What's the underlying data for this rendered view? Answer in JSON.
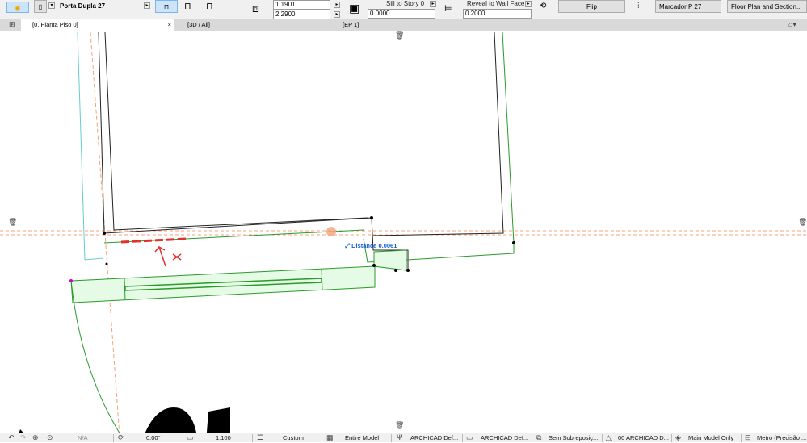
{
  "toolbar": {
    "door_name": "Porta Dupla 27",
    "width_value": "1.1901",
    "height_value": "2.2900",
    "sill_label": "Sill to Story 0",
    "sill_value": "0.0000",
    "reveal_label": "Reveal to Wall Face",
    "reveal_value": "0.2000",
    "flip_label": "Flip",
    "marker_label": "Marcador P 27",
    "floorplan_label": "Floor Plan and Section..."
  },
  "tabs": [
    {
      "label": "[0. Planta Piso 0]"
    },
    {
      "label": "[3D / All]"
    },
    {
      "label": "[EP 1]"
    }
  ],
  "canvas": {
    "distance_label": "Distance",
    "distance_value": "0.0061",
    "accent": "#1a5fd6"
  },
  "status": {
    "zoom": "N/A",
    "angle": "0.00°",
    "scale": "1:100",
    "layer": "Custom",
    "model": "Entire Model",
    "pen_set": "ARCHICAD Def...",
    "model_view": "ARCHICAD Def...",
    "overrides": "Sem Sobreposiç...",
    "renovation": "00 ARCHICAD D...",
    "structure": "Main Model Only",
    "units": "Metro (Precisão ..."
  }
}
